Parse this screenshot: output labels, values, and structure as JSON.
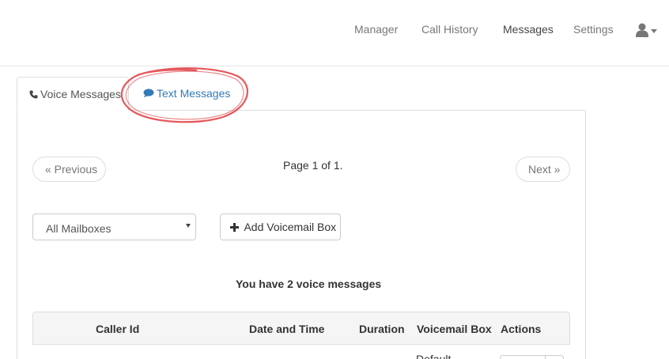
{
  "nav": {
    "items": [
      "Manager",
      "Call History",
      "Messages",
      "Settings"
    ],
    "active": "Messages",
    "user_icon": "user-icon",
    "caret_icon": "caret-down-icon"
  },
  "tabs": {
    "voice": {
      "label": "Voice Messages",
      "icon": "phone-icon"
    },
    "text": {
      "label": "Text Messages",
      "icon": "comment-icon"
    }
  },
  "pager": {
    "previous": "« Previous",
    "next": "Next »",
    "page_info": "Page 1 of 1."
  },
  "mailbox_select": {
    "selected": "All Mailboxes"
  },
  "add_button": {
    "icon": "plus",
    "label": "Add Voicemail Box"
  },
  "summary": "You have 2 voice messages",
  "table": {
    "columns": [
      "Caller Id",
      "Date and Time",
      "Duration",
      "Voicemail Box",
      "Actions"
    ],
    "rows": [
      {
        "voicemail_box": "Default"
      }
    ]
  },
  "colors": {
    "link": "#337ab7",
    "annotation": "#e0393e",
    "nav_text": "#777777"
  }
}
